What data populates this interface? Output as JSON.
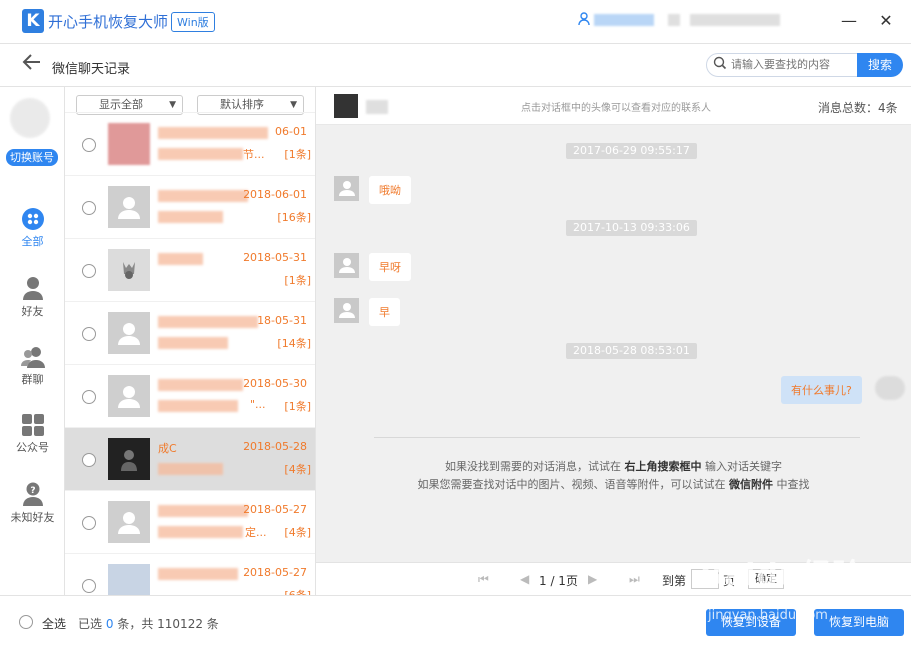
{
  "app": {
    "title": "开心手机恢复大师",
    "edition": "Win版",
    "logo": "K"
  },
  "nav": {
    "title": "微信聊天记录",
    "search_placeholder": "请输入要查找的内容",
    "search_button": "搜索"
  },
  "sidebar": {
    "switch_account": "切换账号",
    "items": [
      {
        "label": "全部",
        "icon": "grid-icon",
        "active": true
      },
      {
        "label": "好友",
        "icon": "person-icon"
      },
      {
        "label": "群聊",
        "icon": "group-icon"
      },
      {
        "label": "公众号",
        "icon": "apps-icon"
      },
      {
        "label": "未知好友",
        "icon": "unknown-person-icon"
      }
    ]
  },
  "list": {
    "filter": "显示全部",
    "sort": "默认排序",
    "rows": [
      {
        "name": "",
        "date": "06-01",
        "snippet": "节...",
        "count": "[1条]"
      },
      {
        "name": "",
        "date": "2018-06-01",
        "snippet": "",
        "count": "[16条]"
      },
      {
        "name": "",
        "date": "2018-05-31",
        "snippet": "",
        "count": "[1条]"
      },
      {
        "name": "",
        "date": "18-05-31",
        "snippet": "",
        "count": "[14条]"
      },
      {
        "name": "",
        "date": "2018-05-30",
        "snippet": "\"...",
        "count": "[1条]"
      },
      {
        "name": "成C",
        "date": "2018-05-28",
        "snippet": "",
        "count": "[4条]"
      },
      {
        "name": "",
        "date": "2018-05-27",
        "snippet": "定...",
        "count": "[4条]"
      },
      {
        "name": "",
        "date": "2018-05-27",
        "snippet": "",
        "count": "[6条]"
      }
    ]
  },
  "chat": {
    "hint": "点击对话框中的头像可以查看对应的联系人",
    "total": "消息总数：4条",
    "messages": [
      {
        "time": "2017-06-29 09:55:17",
        "text": "哦呦"
      },
      {
        "time": "2017-10-13 09:33:06",
        "text": "早呀"
      },
      {
        "time": "",
        "text": "早"
      },
      {
        "time": "2018-05-28 08:53:01",
        "text": "有什么事儿?"
      }
    ],
    "tip_1a": "如果没找到需要的对话消息，试试在 ",
    "tip_1b": "右上角搜索框中",
    "tip_1c": " 输入对话关键字",
    "tip_2a": "如果您需要查找对话中的图片、视频、语音等附件，可以试试在 ",
    "tip_2b": "微信附件",
    "tip_2c": " 中查找"
  },
  "pager": {
    "info": "1 / 1页",
    "goto": "到第",
    "unit": "页",
    "go": "确定"
  },
  "footer": {
    "select_all": "全选",
    "selected_prefix": "已选",
    "selected_count": "0",
    "selected_mid": "条，共",
    "selected_total": "110122",
    "selected_suffix": "条",
    "restore_device": "恢复到设备",
    "restore_pc": "恢复到电脑"
  },
  "watermark": {
    "main": "Baidu经验",
    "sub": "jingyan.baidu.com"
  },
  "colors": {
    "accent": "#2f86f0",
    "highlight": "#f07a2c"
  }
}
